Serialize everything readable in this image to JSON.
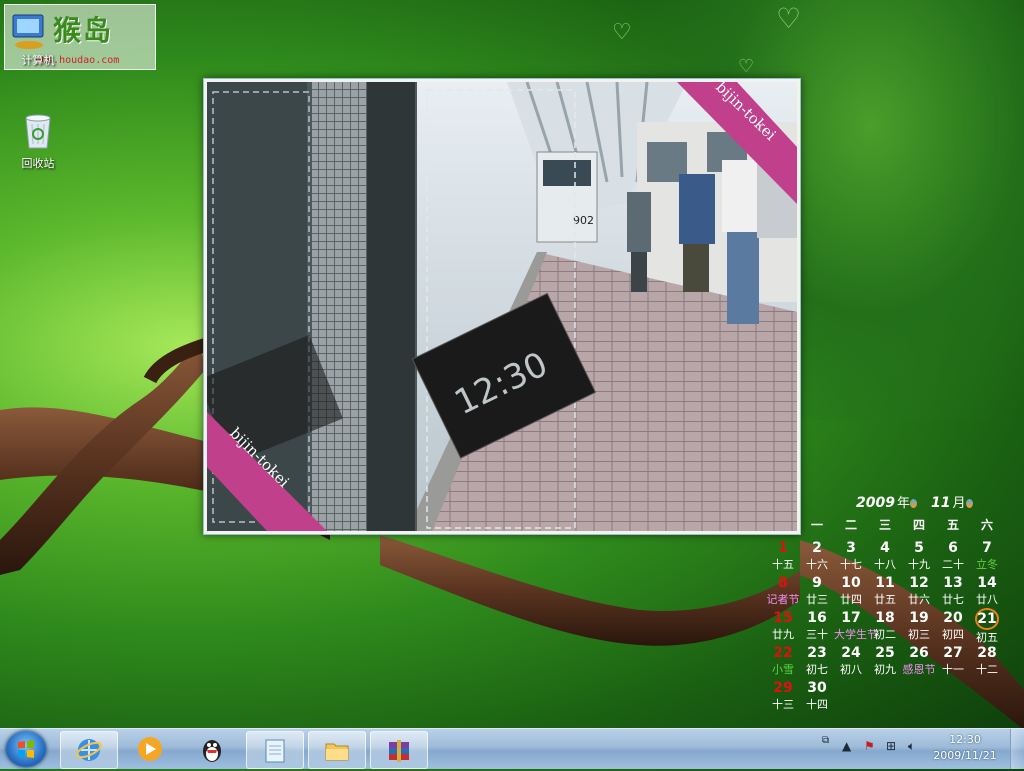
{
  "watermark": {
    "brand": "猴岛",
    "url": "bbs.houdao.com"
  },
  "desktop": {
    "icons": [
      {
        "label": "计算机",
        "icon": "computer-icon"
      },
      {
        "label": "回收站",
        "icon": "recycle-bin-icon"
      }
    ]
  },
  "photo_gadget": {
    "ribbon_text": "bijin-tokei",
    "board_time": "12:30"
  },
  "calendar": {
    "year": "2009",
    "year_unit": "年",
    "month": "11",
    "month_unit": "月",
    "weekdays": [
      "一",
      "二",
      "三",
      "四",
      "五",
      "六"
    ],
    "days": [
      {
        "n": "1",
        "l": "十五",
        "c": 6
      },
      {
        "n": "2",
        "l": "十六",
        "c": 0
      },
      {
        "n": "3",
        "l": "十七",
        "c": 1
      },
      {
        "n": "4",
        "l": "十八",
        "c": 2
      },
      {
        "n": "5",
        "l": "十九",
        "c": 3
      },
      {
        "n": "6",
        "l": "二十",
        "c": 4
      },
      {
        "n": "7",
        "l": "立冬",
        "c": 5,
        "type": "term"
      },
      {
        "n": "8",
        "l": "记者节",
        "c": 6,
        "type": "fest"
      },
      {
        "n": "9",
        "l": "廿三",
        "c": 0
      },
      {
        "n": "10",
        "l": "廿四",
        "c": 1
      },
      {
        "n": "11",
        "l": "廿五",
        "c": 2
      },
      {
        "n": "12",
        "l": "廿六",
        "c": 3
      },
      {
        "n": "13",
        "l": "廿七",
        "c": 4
      },
      {
        "n": "14",
        "l": "廿八",
        "c": 5
      },
      {
        "n": "15",
        "l": "廿九",
        "c": 6
      },
      {
        "n": "16",
        "l": "三十",
        "c": 0
      },
      {
        "n": "17",
        "l": "大学生节",
        "c": 1,
        "type": "fest"
      },
      {
        "n": "18",
        "l": "初二",
        "c": 2
      },
      {
        "n": "19",
        "l": "初三",
        "c": 3
      },
      {
        "n": "20",
        "l": "初四",
        "c": 4
      },
      {
        "n": "21",
        "l": "初五",
        "c": 5,
        "today": true
      },
      {
        "n": "22",
        "l": "小雪",
        "c": 6,
        "type": "term"
      },
      {
        "n": "23",
        "l": "初七",
        "c": 0
      },
      {
        "n": "24",
        "l": "初八",
        "c": 1
      },
      {
        "n": "25",
        "l": "初九",
        "c": 2
      },
      {
        "n": "26",
        "l": "感恩节",
        "c": 3,
        "type": "fest"
      },
      {
        "n": "27",
        "l": "十一",
        "c": 4
      },
      {
        "n": "28",
        "l": "十二",
        "c": 5
      },
      {
        "n": "29",
        "l": "十三",
        "c": 6
      },
      {
        "n": "30",
        "l": "十四",
        "c": 0
      }
    ]
  },
  "taskbar": {
    "pinned": [
      {
        "icon": "internet-explorer-icon",
        "active": true
      },
      {
        "icon": "media-player-icon"
      },
      {
        "icon": "qq-penguin-icon"
      },
      {
        "icon": "notepad-icon",
        "active": true
      },
      {
        "icon": "windows-explorer-folder-icon",
        "active": true
      },
      {
        "icon": "winrar-icon",
        "active": true
      }
    ],
    "tray_icons": [
      "tray-expand-icon",
      "action-center-flag-icon",
      "network-icon",
      "volume-icon"
    ],
    "clock_time": "12:30",
    "clock_date": "2009/11/21"
  },
  "colors": {
    "sunday": "#e01010",
    "festival": "#f090f0",
    "solar_term": "#5fd040",
    "today_ring": "#f08010"
  }
}
